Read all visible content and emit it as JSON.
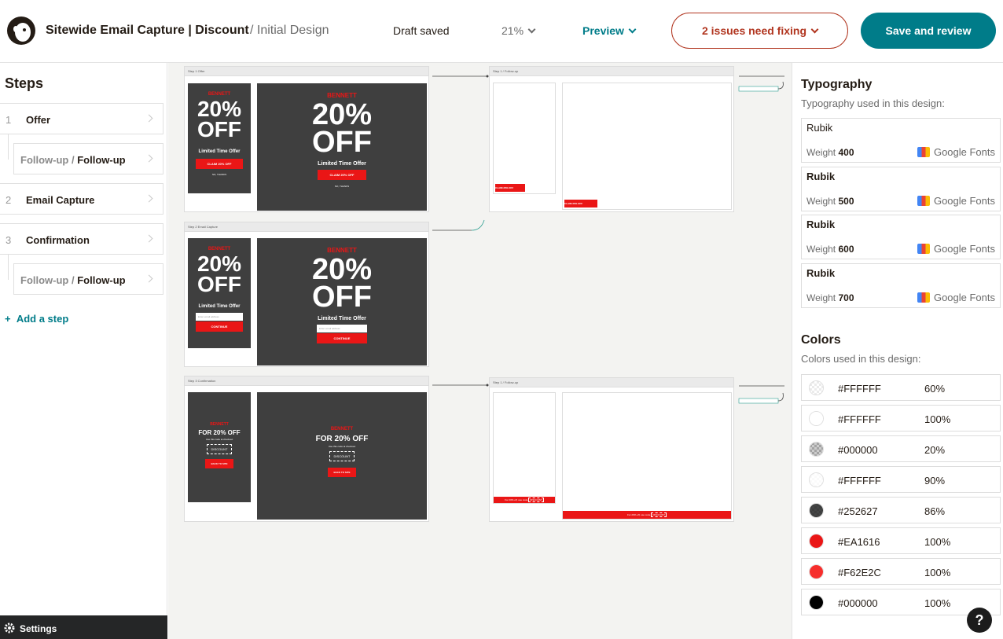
{
  "header": {
    "title": "Sitewide Email Capture | Discount",
    "subtitle": "/ Initial Design",
    "draft_status": "Draft saved",
    "zoom": "21%",
    "preview_label": "Preview",
    "issues_label": "2 issues need fixing",
    "save_label": "Save and review"
  },
  "sidebar": {
    "title": "Steps",
    "steps": [
      {
        "num": "1",
        "label": "Offer"
      },
      {
        "prefix": "Follow-up /",
        "label": "Follow-up"
      },
      {
        "num": "2",
        "label": "Email Capture"
      },
      {
        "num": "3",
        "label": "Confirmation"
      },
      {
        "prefix": "Follow-up /",
        "label": "Follow-up"
      }
    ],
    "add_step": "Add a step",
    "settings": "Settings"
  },
  "canvas": {
    "brand": "BENNETT",
    "discount": "20%",
    "off": "OFF",
    "limited": "Limited Time Offer",
    "claim": "CLAIM 20% OFF",
    "no_thanks": "NO, THANKS",
    "email_placeholder": "Enter email address",
    "continue": "CONTINUE",
    "for_off": "FOR 20% OFF",
    "use_code": "Use this code at checkout",
    "code": "DISCOUNT",
    "back": "BACK TO SITE",
    "fu_bar": "For 20% off, use code",
    "step1_head": "Step 1 Offer",
    "step2_head": "Step 2 Email Capture",
    "step3_head": "Step 3 Confirmation",
    "fu_head": "Step 1 / Follow-up"
  },
  "typography": {
    "title": "Typography",
    "subtitle": "Typography used in this design:",
    "fonts": [
      {
        "name": "Rubik",
        "weight_label": "Weight",
        "weight": "400",
        "source": "Google Fonts"
      },
      {
        "name": "Rubik",
        "weight_label": "Weight",
        "weight": "500",
        "source": "Google Fonts"
      },
      {
        "name": "Rubik",
        "weight_label": "Weight",
        "weight": "600",
        "source": "Google Fonts"
      },
      {
        "name": "Rubik",
        "weight_label": "Weight",
        "weight": "700",
        "source": "Google Fonts"
      }
    ]
  },
  "colors": {
    "title": "Colors",
    "subtitle": "Colors used in this design:",
    "items": [
      {
        "hex": "#FFFFFF",
        "pct": "60%",
        "swatch": "#ffffff",
        "alpha": 0.6
      },
      {
        "hex": "#FFFFFF",
        "pct": "100%",
        "swatch": "#ffffff",
        "alpha": 1
      },
      {
        "hex": "#000000",
        "pct": "20%",
        "swatch": "#000000",
        "alpha": 0.2
      },
      {
        "hex": "#FFFFFF",
        "pct": "90%",
        "swatch": "#ffffff",
        "alpha": 0.9
      },
      {
        "hex": "#252627",
        "pct": "86%",
        "swatch": "#252627",
        "alpha": 0.86
      },
      {
        "hex": "#EA1616",
        "pct": "100%",
        "swatch": "#ea1616",
        "alpha": 1
      },
      {
        "hex": "#F62E2C",
        "pct": "100%",
        "swatch": "#f62e2c",
        "alpha": 1
      },
      {
        "hex": "#000000",
        "pct": "100%",
        "swatch": "#000000",
        "alpha": 1
      }
    ]
  },
  "help": "?"
}
